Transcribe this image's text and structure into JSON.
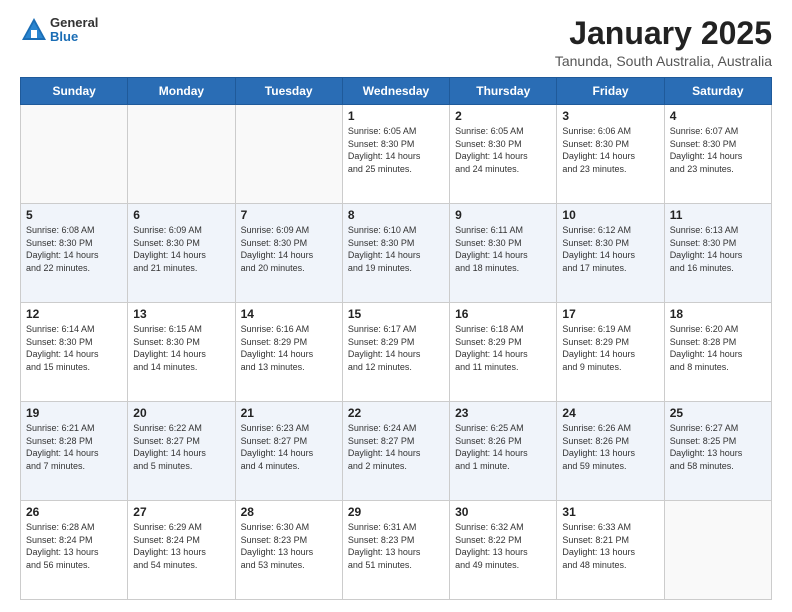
{
  "header": {
    "logo_line1": "General",
    "logo_line2": "Blue",
    "month": "January 2025",
    "location": "Tanunda, South Australia, Australia"
  },
  "weekdays": [
    "Sunday",
    "Monday",
    "Tuesday",
    "Wednesday",
    "Thursday",
    "Friday",
    "Saturday"
  ],
  "weeks": [
    [
      {
        "day": "",
        "info": ""
      },
      {
        "day": "",
        "info": ""
      },
      {
        "day": "",
        "info": ""
      },
      {
        "day": "1",
        "info": "Sunrise: 6:05 AM\nSunset: 8:30 PM\nDaylight: 14 hours\nand 25 minutes."
      },
      {
        "day": "2",
        "info": "Sunrise: 6:05 AM\nSunset: 8:30 PM\nDaylight: 14 hours\nand 24 minutes."
      },
      {
        "day": "3",
        "info": "Sunrise: 6:06 AM\nSunset: 8:30 PM\nDaylight: 14 hours\nand 23 minutes."
      },
      {
        "day": "4",
        "info": "Sunrise: 6:07 AM\nSunset: 8:30 PM\nDaylight: 14 hours\nand 23 minutes."
      }
    ],
    [
      {
        "day": "5",
        "info": "Sunrise: 6:08 AM\nSunset: 8:30 PM\nDaylight: 14 hours\nand 22 minutes."
      },
      {
        "day": "6",
        "info": "Sunrise: 6:09 AM\nSunset: 8:30 PM\nDaylight: 14 hours\nand 21 minutes."
      },
      {
        "day": "7",
        "info": "Sunrise: 6:09 AM\nSunset: 8:30 PM\nDaylight: 14 hours\nand 20 minutes."
      },
      {
        "day": "8",
        "info": "Sunrise: 6:10 AM\nSunset: 8:30 PM\nDaylight: 14 hours\nand 19 minutes."
      },
      {
        "day": "9",
        "info": "Sunrise: 6:11 AM\nSunset: 8:30 PM\nDaylight: 14 hours\nand 18 minutes."
      },
      {
        "day": "10",
        "info": "Sunrise: 6:12 AM\nSunset: 8:30 PM\nDaylight: 14 hours\nand 17 minutes."
      },
      {
        "day": "11",
        "info": "Sunrise: 6:13 AM\nSunset: 8:30 PM\nDaylight: 14 hours\nand 16 minutes."
      }
    ],
    [
      {
        "day": "12",
        "info": "Sunrise: 6:14 AM\nSunset: 8:30 PM\nDaylight: 14 hours\nand 15 minutes."
      },
      {
        "day": "13",
        "info": "Sunrise: 6:15 AM\nSunset: 8:30 PM\nDaylight: 14 hours\nand 14 minutes."
      },
      {
        "day": "14",
        "info": "Sunrise: 6:16 AM\nSunset: 8:29 PM\nDaylight: 14 hours\nand 13 minutes."
      },
      {
        "day": "15",
        "info": "Sunrise: 6:17 AM\nSunset: 8:29 PM\nDaylight: 14 hours\nand 12 minutes."
      },
      {
        "day": "16",
        "info": "Sunrise: 6:18 AM\nSunset: 8:29 PM\nDaylight: 14 hours\nand 11 minutes."
      },
      {
        "day": "17",
        "info": "Sunrise: 6:19 AM\nSunset: 8:29 PM\nDaylight: 14 hours\nand 9 minutes."
      },
      {
        "day": "18",
        "info": "Sunrise: 6:20 AM\nSunset: 8:28 PM\nDaylight: 14 hours\nand 8 minutes."
      }
    ],
    [
      {
        "day": "19",
        "info": "Sunrise: 6:21 AM\nSunset: 8:28 PM\nDaylight: 14 hours\nand 7 minutes."
      },
      {
        "day": "20",
        "info": "Sunrise: 6:22 AM\nSunset: 8:27 PM\nDaylight: 14 hours\nand 5 minutes."
      },
      {
        "day": "21",
        "info": "Sunrise: 6:23 AM\nSunset: 8:27 PM\nDaylight: 14 hours\nand 4 minutes."
      },
      {
        "day": "22",
        "info": "Sunrise: 6:24 AM\nSunset: 8:27 PM\nDaylight: 14 hours\nand 2 minutes."
      },
      {
        "day": "23",
        "info": "Sunrise: 6:25 AM\nSunset: 8:26 PM\nDaylight: 14 hours\nand 1 minute."
      },
      {
        "day": "24",
        "info": "Sunrise: 6:26 AM\nSunset: 8:26 PM\nDaylight: 13 hours\nand 59 minutes."
      },
      {
        "day": "25",
        "info": "Sunrise: 6:27 AM\nSunset: 8:25 PM\nDaylight: 13 hours\nand 58 minutes."
      }
    ],
    [
      {
        "day": "26",
        "info": "Sunrise: 6:28 AM\nSunset: 8:24 PM\nDaylight: 13 hours\nand 56 minutes."
      },
      {
        "day": "27",
        "info": "Sunrise: 6:29 AM\nSunset: 8:24 PM\nDaylight: 13 hours\nand 54 minutes."
      },
      {
        "day": "28",
        "info": "Sunrise: 6:30 AM\nSunset: 8:23 PM\nDaylight: 13 hours\nand 53 minutes."
      },
      {
        "day": "29",
        "info": "Sunrise: 6:31 AM\nSunset: 8:23 PM\nDaylight: 13 hours\nand 51 minutes."
      },
      {
        "day": "30",
        "info": "Sunrise: 6:32 AM\nSunset: 8:22 PM\nDaylight: 13 hours\nand 49 minutes."
      },
      {
        "day": "31",
        "info": "Sunrise: 6:33 AM\nSunset: 8:21 PM\nDaylight: 13 hours\nand 48 minutes."
      },
      {
        "day": "",
        "info": ""
      }
    ]
  ]
}
